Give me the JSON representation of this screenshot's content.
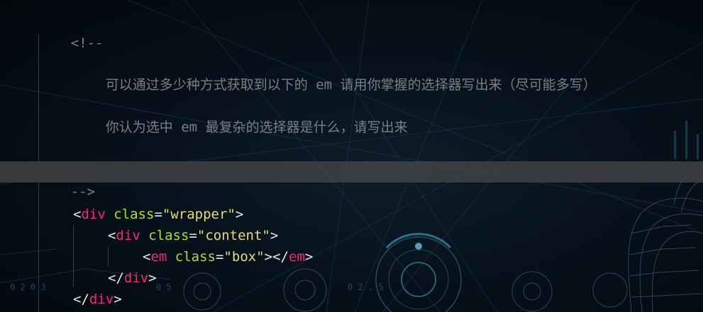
{
  "editor": {
    "comment_open": "<!--",
    "comment_line1_prefix": "可以通过多少种方式获取到以下的",
    "comment_line1_em": "em",
    "comment_line1_suffix": "请用你掌握的选择器写出来（尽可能多写）",
    "comment_line2_prefix": "你认为选中",
    "comment_line2_em": "em",
    "comment_line2_suffix": "最复杂的选择器是什么，请写出来",
    "comment_close": "-->"
  },
  "code": {
    "lt": "<",
    "gt": ">",
    "lt_slash": "</",
    "eq": "=",
    "line1": {
      "tag": "div",
      "attr": "class",
      "value": "\"wrapper\""
    },
    "line2": {
      "tag": "div",
      "attr": "class",
      "value": "\"content\""
    },
    "line3": {
      "tag": "em",
      "attr": "class",
      "value": "\"box\"",
      "close_tag": "em"
    },
    "line4": {
      "close_tag": "div"
    },
    "line5": {
      "close_tag": "div"
    }
  },
  "background": {
    "hud_digits_left": "0 2      0 3",
    "hud_digits_mid": "0 5",
    "hud_digits_right": "0 2 . 5"
  },
  "theme": {
    "comment": "#7a7f86",
    "tag": "#f92672",
    "attr": "#a6e22e",
    "string": "#e6db74",
    "highlight": "#484848"
  }
}
